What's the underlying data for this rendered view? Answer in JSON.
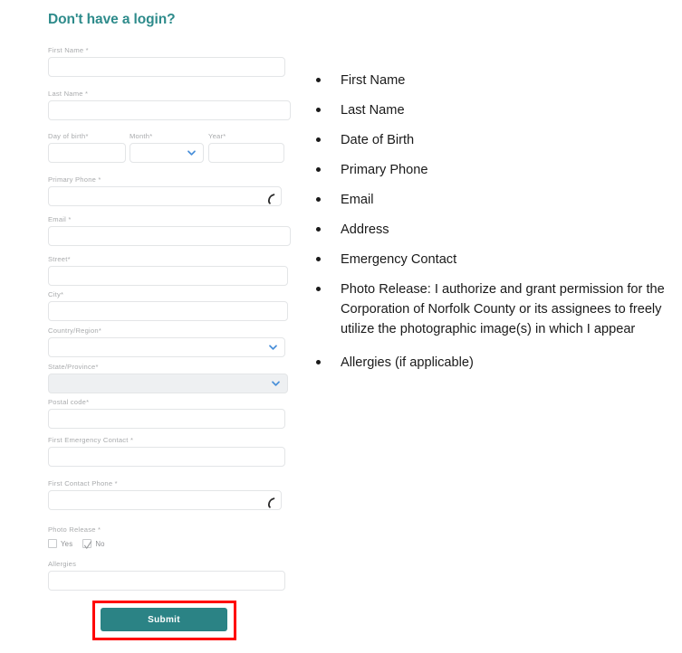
{
  "form": {
    "heading": "Don't have a login?",
    "fields": {
      "first_name": {
        "label": "First Name *",
        "value": ""
      },
      "last_name": {
        "label": "Last Name *",
        "value": ""
      },
      "day_of_birth": {
        "label": "Day of birth*",
        "value": ""
      },
      "month": {
        "label": "Month*",
        "value": ""
      },
      "year": {
        "label": "Year*",
        "value": ""
      },
      "primary_phone": {
        "label": "Primary Phone *",
        "value": "",
        "icon": "phone-icon"
      },
      "email": {
        "label": "Email *",
        "value": ""
      },
      "street": {
        "label": "Street*",
        "value": ""
      },
      "city": {
        "label": "City*",
        "value": ""
      },
      "country_region": {
        "label": "Country/Region*",
        "value": "",
        "icon": "chevron-down-icon"
      },
      "state_province": {
        "label": "State/Province*",
        "value": "",
        "icon": "chevron-down-icon",
        "disabled": true
      },
      "postal_code": {
        "label": "Postal code*",
        "value": ""
      },
      "first_emergency_contact": {
        "label": "First Emergency Contact *",
        "value": ""
      },
      "first_contact_phone": {
        "label": "First Contact Phone *",
        "value": "",
        "icon": "phone-icon"
      },
      "photo_release": {
        "label": "Photo Release *"
      },
      "allergies": {
        "label": "Allergies",
        "value": ""
      }
    },
    "photo_release_options": [
      {
        "label": "Yes",
        "checked": false
      },
      {
        "label": "No",
        "checked": true
      }
    ],
    "submit_label": "Submit"
  },
  "requirements": {
    "items": [
      "First Name",
      "Last Name",
      "Date of Birth",
      "Primary Phone",
      "Email",
      "Address",
      "Emergency Contact",
      "Photo Release: I authorize and grant permission for the Corporation of Norfolk County or its assignees to freely utilize the photographic image(s) in which I appear",
      "Allergies (if applicable)"
    ]
  },
  "colors": {
    "heading_teal": "#2e8b8b",
    "submit_teal": "#2b8385",
    "highlight_red": "#ff0000",
    "label_grey": "#a9abad",
    "border_grey": "#e3e5e7",
    "disabled_grey": "#eef0f2",
    "chevron_blue": "#4a90d9"
  }
}
